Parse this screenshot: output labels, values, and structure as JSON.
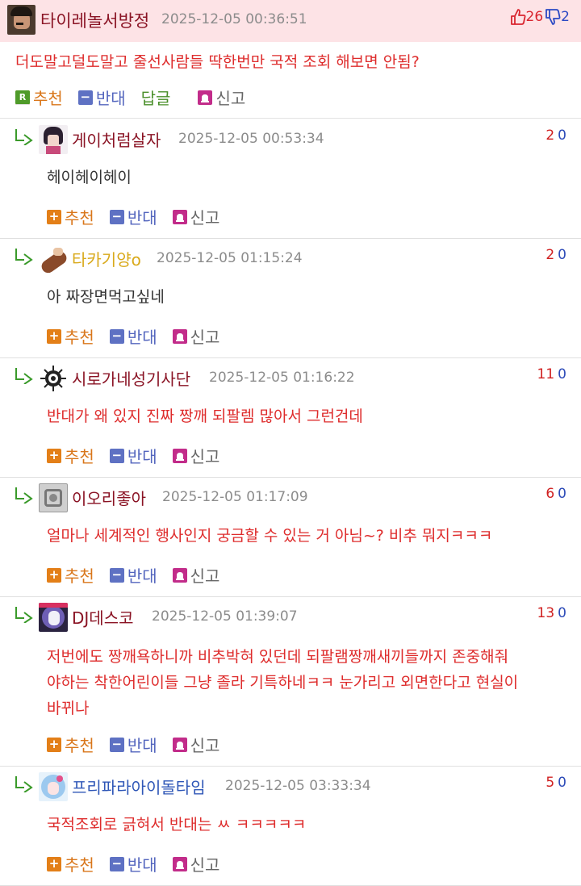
{
  "post": {
    "author": "타이레놀서방정",
    "date": "2025-12-05 00:36:51",
    "upvotes": "26",
    "downvotes": "2",
    "body": "더도말고덜도말고 줄선사람들 딱한번만 국적 조회 해보면 안됨?",
    "actions": {
      "recommend": "추천",
      "oppose": "반대",
      "reply": "답글",
      "report": "신고"
    },
    "icons": {
      "upvote": "thumbs-up-icon",
      "downvote": "thumbs-down-icon"
    }
  },
  "replies": [
    {
      "author": "게이처럼살자",
      "author_color": "#8a1324",
      "date": "2025-12-05 00:53:34",
      "up": "2",
      "down": "0",
      "lines": [
        "헤이헤이헤이"
      ],
      "text_color": "black"
    },
    {
      "author": "타카기양o",
      "author_color": "#d9a91a",
      "date": "2025-12-05 01:15:24",
      "up": "2",
      "down": "0",
      "lines": [
        "아 짜장면먹고싶네"
      ],
      "text_color": "black"
    },
    {
      "author": "시로가네성기사단",
      "author_color": "#8a1324",
      "date": "2025-12-05 01:16:22",
      "up": "11",
      "down": "0",
      "lines": [
        "반대가 왜 있지 진짜 짱깨 되팔렘 많아서 그런건데"
      ],
      "text_color": "red"
    },
    {
      "author": "이오리좋아",
      "author_color": "#8a1324",
      "date": "2025-12-05 01:17:09",
      "up": "6",
      "down": "0",
      "lines": [
        "얼마나 세계적인 행사인지 궁금할 수 있는 거 아님~? 비추 뭐지ㅋㅋㅋ"
      ],
      "text_color": "red"
    },
    {
      "author": "DJ데스코",
      "author_color": "#8a1324",
      "date": "2025-12-05 01:39:07",
      "up": "13",
      "down": "0",
      "lines": [
        "저번에도 짱깨욕하니까 비추박혀 있던데 되팔램짱깨새끼들까지 존중해줘",
        "야하는 착한어린이들 그냥 졸라 기특하네ㅋㅋ 눈가리고 외면한다고 현실이",
        "바뀌나"
      ],
      "text_color": "red"
    },
    {
      "author": "프리파라아이돌타임",
      "author_color": "#2f57b7",
      "date": "2025-12-05 03:33:34",
      "up": "5",
      "down": "0",
      "lines": [
        "국적조회로 긁혀서 반대는 ㅆ ㅋㅋㅋㅋㅋ"
      ],
      "text_color": "red"
    }
  ],
  "reply_actions": {
    "recommend": "추천",
    "oppose": "반대",
    "report": "신고"
  },
  "colors": {
    "header_bg": "#fde3e6",
    "accent_red": "#de2c2c",
    "recommend": "#e37f18",
    "oppose": "#5e71c3",
    "report": "#c22c8a",
    "reply_green": "#4f9b2a"
  }
}
